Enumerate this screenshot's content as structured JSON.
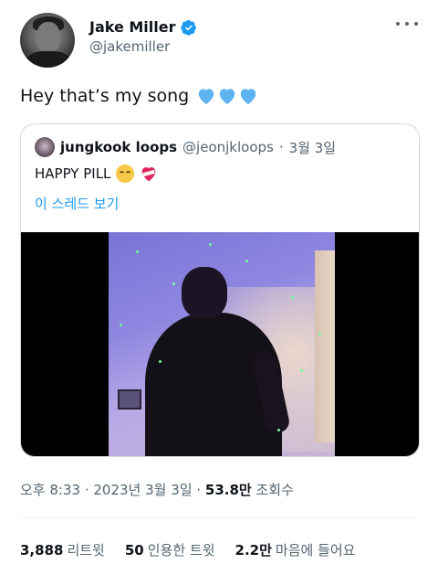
{
  "author": {
    "display_name": "Jake Miller",
    "handle": "@jakemiller",
    "verified": true
  },
  "tweet": {
    "text": "Hey that’s my song",
    "emoji": [
      "blue-heart",
      "blue-heart",
      "blue-heart"
    ]
  },
  "quoted": {
    "display_name": "jungkook loops",
    "handle": "@jeonjkloops",
    "separator": "·",
    "date": "3월 3일",
    "text": "HAPPY PILL",
    "emoji": [
      "smiling-face-with-hearts",
      "mending-heart"
    ],
    "thread_link": "이 스레드 보기"
  },
  "meta": {
    "time": "오후 8:33",
    "date": "2023년 3월 3일",
    "views_count": "53.8만",
    "views_label": "조회수"
  },
  "stats": {
    "retweets_count": "3,888",
    "retweets_label": "리트윗",
    "quotes_count": "50",
    "quotes_label": "인용한 트윗",
    "likes_count": "2.2만",
    "likes_label": "마음에 들어요"
  },
  "colors": {
    "link": "#1d9bf0",
    "verified": "#1d9bf0",
    "heart": "#5db3f0",
    "muted": "#536471"
  }
}
